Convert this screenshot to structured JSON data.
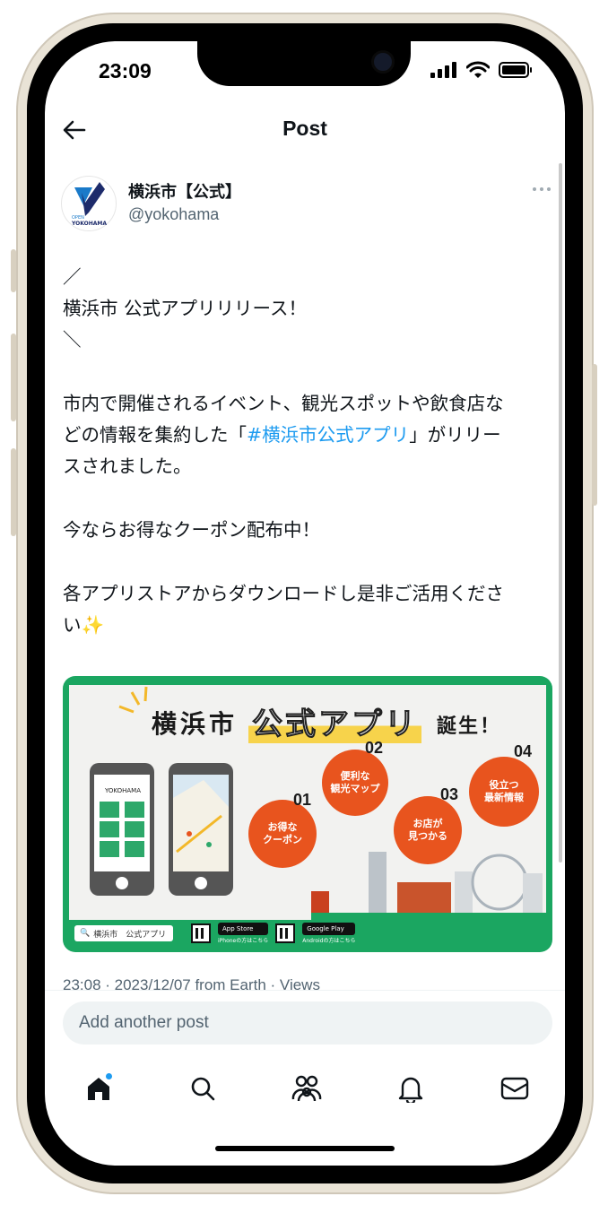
{
  "status_bar": {
    "time": "23:09"
  },
  "nav": {
    "title": "Post"
  },
  "author": {
    "display_name": "横浜市【公式】",
    "handle": "@yokohama",
    "avatar_text_top": "OPEN",
    "avatar_text_bottom": "YOKOHAMA"
  },
  "post": {
    "line1": "／",
    "line2": "横浜市 公式アプリリリース！",
    "line3": "＼",
    "line4": "市内で開催されるイベント、観光スポットや飲食店な",
    "line5_before": "どの情報を集約した「",
    "line5_hashtag": "#横浜市公式アプリ",
    "line5_after": "」がリリー",
    "line6": "スされました。",
    "line7": "今ならお得なクーポン配布中！",
    "line8": "各アプリストアからダウンロードし是非ご活用くださ",
    "line9": "い✨"
  },
  "image": {
    "title_city": "横浜市",
    "title_app": "公式アプリ",
    "title_birth": "誕生！",
    "phone_app_name": "YOKOHAMA",
    "bubbles": [
      {
        "num": "01",
        "text": "お得な\nクーポン"
      },
      {
        "num": "02",
        "text": "便利な\n観光マップ"
      },
      {
        "num": "03",
        "text": "お店が\n見つかる"
      },
      {
        "num": "04",
        "text": "役立つ\n最新情報"
      }
    ],
    "search_text": "横浜市　公式アプリ",
    "app_store": "App Store",
    "google_play": "Google Play",
    "iphone_note": "iPhoneの方はこちら",
    "android_note": "Androidの方はこちら"
  },
  "timestamp": "23:08 · 2023/12/07 from Earth · Views",
  "reply": {
    "placeholder": "Add another post"
  },
  "tabs": [
    "home-icon",
    "search-icon",
    "communities-icon",
    "notifications-icon",
    "messages-icon"
  ],
  "colors": {
    "link": "#1d9bf0",
    "banner_green": "#1ba661",
    "bubble_orange": "#e8541e"
  }
}
